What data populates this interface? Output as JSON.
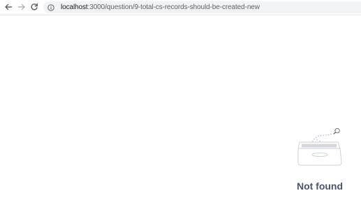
{
  "browser": {
    "url_host": "localhost",
    "url_path": ":3000/question/9-total-cs-records-should-be-created-new",
    "icons": {
      "back": "arrow-left-icon",
      "forward": "arrow-right-icon",
      "reload": "reload-icon",
      "site_info": "info-circle-icon"
    }
  },
  "main": {
    "empty_state": {
      "title": "Not found",
      "illustration": "empty-box-icon"
    }
  },
  "colors": {
    "title": "#4a5568",
    "omnibox_bg": "#f1f3f4",
    "icon": "#5f6368"
  }
}
